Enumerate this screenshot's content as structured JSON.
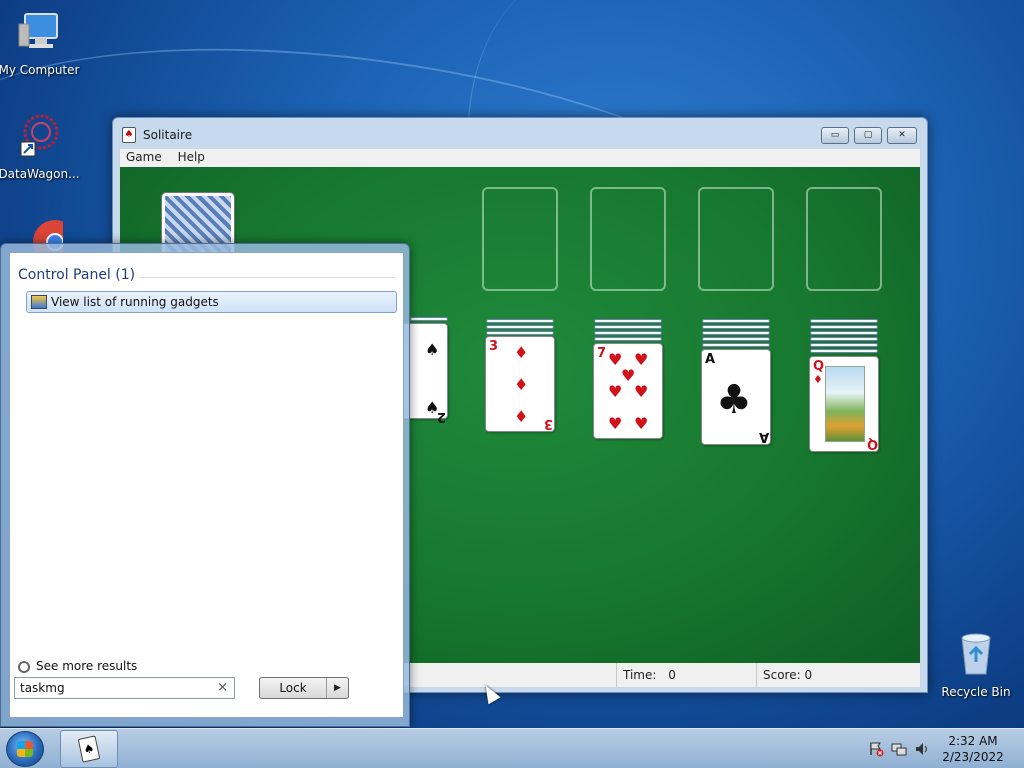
{
  "desktop": {
    "icons": [
      {
        "label": "My Computer",
        "icon": "computer-icon"
      },
      {
        "label": "DataWagon...",
        "icon": "datawagon-icon"
      },
      {
        "label": "",
        "icon": "chrome-icon"
      },
      {
        "label": "Recycle Bin",
        "icon": "recycle-bin-icon"
      }
    ]
  },
  "window": {
    "title": "Solitaire",
    "menu": [
      "Game",
      "Help"
    ],
    "controls": {
      "minimize": "▭",
      "maximize": "▢",
      "close": "✕"
    },
    "status": {
      "time_label": "Time:",
      "time_value": "0",
      "score_label": "Score:",
      "score_value": "0"
    }
  },
  "tableau": [
    {
      "rank": "2",
      "suit": "♠",
      "color": "black"
    },
    {
      "rank": "3",
      "suit": "♦",
      "color": "red"
    },
    {
      "rank": "7",
      "suit": "♥",
      "color": "red"
    },
    {
      "rank": "A",
      "suit": "♣",
      "color": "black"
    },
    {
      "rank": "Q",
      "suit": "♦",
      "color": "red"
    }
  ],
  "start_menu": {
    "heading": "Control Panel (1)",
    "result": "View list of running gadgets",
    "see_more": "See more results",
    "search_value": "taskmg",
    "clear_glyph": "×",
    "lock_label": "Lock",
    "lock_arrow": "▶"
  },
  "taskbar": {
    "time": "2:32 AM",
    "date": "2/23/2022",
    "tray_icons": [
      "action-center-icon",
      "network-icon",
      "volume-icon"
    ]
  }
}
